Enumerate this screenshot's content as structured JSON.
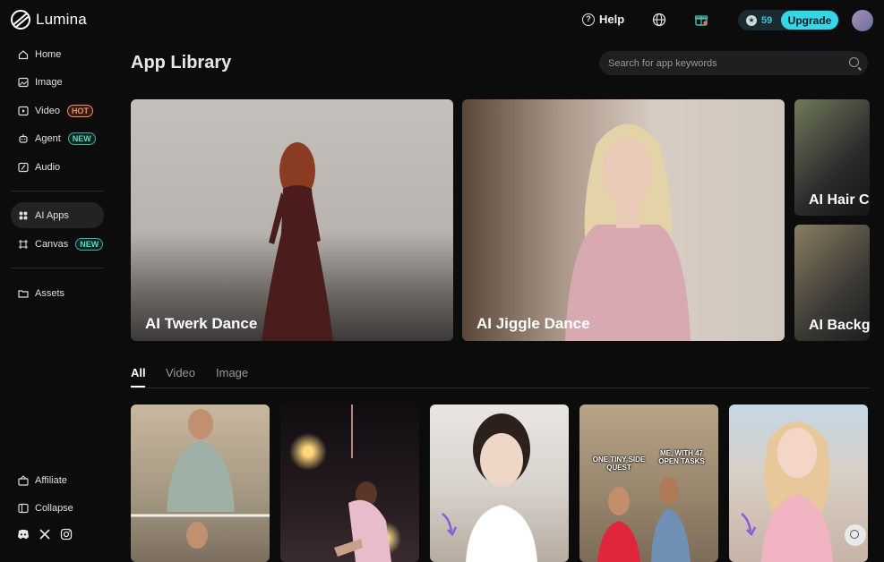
{
  "app": {
    "name": "Lumina"
  },
  "header": {
    "help_label": "Help",
    "credits": "59",
    "upgrade_label": "Upgrade"
  },
  "sidebar": {
    "items": [
      {
        "label": "Home",
        "icon": "home-icon"
      },
      {
        "label": "Image",
        "icon": "image-icon"
      },
      {
        "label": "Video",
        "icon": "video-icon",
        "badge": "HOT"
      },
      {
        "label": "Agent",
        "icon": "agent-icon",
        "badge": "NEW"
      },
      {
        "label": "Audio",
        "icon": "audio-icon"
      },
      {
        "label": "AI Apps",
        "icon": "apps-icon",
        "active": true
      },
      {
        "label": "Canvas",
        "icon": "canvas-icon",
        "badge": "NEW"
      },
      {
        "label": "Assets",
        "icon": "folder-icon"
      }
    ],
    "bottom": [
      {
        "label": "Affiliate",
        "icon": "affiliate-icon"
      },
      {
        "label": "Collapse",
        "icon": "collapse-icon"
      }
    ],
    "social_icons": [
      "discord-icon",
      "x-icon",
      "instagram-icon"
    ]
  },
  "main": {
    "title": "App Library",
    "search_placeholder": "Search for app keywords",
    "featured": [
      {
        "label": "AI Twerk Dance"
      },
      {
        "label": "AI Jiggle Dance"
      },
      {
        "label": "AI Hair C"
      },
      {
        "label": "AI Backg"
      }
    ],
    "tabs": [
      {
        "label": "All",
        "active": true
      },
      {
        "label": "Video"
      },
      {
        "label": "Image"
      }
    ],
    "meme_text": {
      "left": "ONE TINY SIDE QUEST",
      "right": "ME, WITH 47 OPEN TASKS"
    }
  },
  "colors": {
    "accent": "#35d6e6",
    "background": "#0c0c0d",
    "hot_badge": "#ff8a5c",
    "new_badge": "#4fe0c8"
  }
}
